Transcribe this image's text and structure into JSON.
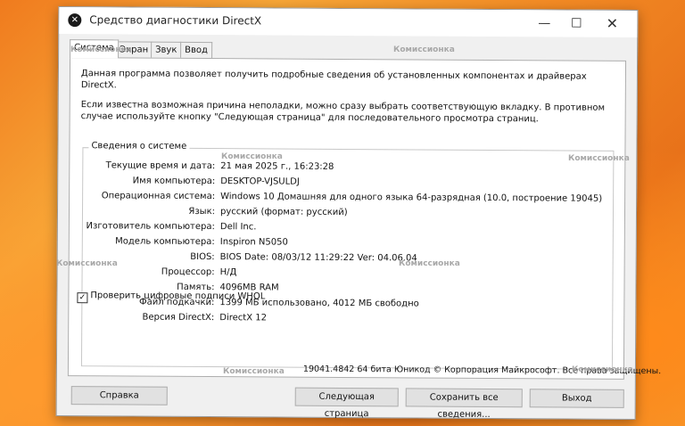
{
  "window": {
    "title": "Средство диагностики DirectX",
    "min_glyph": "—",
    "max_glyph": "☐",
    "close_glyph": "✕"
  },
  "tabs": [
    {
      "label": "Система"
    },
    {
      "label": "Экран"
    },
    {
      "label": "Звук"
    },
    {
      "label": "Ввод"
    }
  ],
  "intro": {
    "line1": "Данная программа позволяет получить подробные сведения об установленных компонентах и драйверах DirectX.",
    "line2": "Если известна возможная причина неполадки, можно сразу выбрать соответствующую вкладку. В противном случае используйте кнопку \"Следующая страница\" для последовательного просмотра страниц."
  },
  "system_info": {
    "title": "Сведения о системе",
    "rows": [
      {
        "label": "Текущие время и дата:",
        "value": "21 мая 2025 г., 16:23:28"
      },
      {
        "label": "Имя компьютера:",
        "value": "DESKTOP-VJSULDJ"
      },
      {
        "label": "Операционная система:",
        "value": "Windows 10 Домашняя для одного языка 64-разрядная (10.0, построение 19045)"
      },
      {
        "label": "Язык:",
        "value": "русский (формат: русский)"
      },
      {
        "label": "Изготовитель компьютера:",
        "value": "Dell Inc."
      },
      {
        "label": "Модель компьютера:",
        "value": "Inspiron N5050"
      },
      {
        "label": "BIOS:",
        "value": "BIOS Date: 08/03/12 11:29:22 Ver: 04.06.04"
      },
      {
        "label": "Процессор:",
        "value": "Н/Д"
      },
      {
        "label": "Память:",
        "value": "4096MB RAM"
      },
      {
        "label": "Файл подкачки:",
        "value": "1399 МБ использовано, 4012 МБ свободно"
      },
      {
        "label": "Версия DirectX:",
        "value": "DirectX 12"
      }
    ]
  },
  "whql": {
    "label": "Проверить цифровые подписи WHQL",
    "checked": true,
    "mark": "✓"
  },
  "footer": "19041.4842 64 бита Юникод © Корпорация Майкрософт. Все права защищены.",
  "buttons": {
    "help": "Справка",
    "next": "Следующая страница",
    "save": "Сохранить все сведения...",
    "exit": "Выход"
  },
  "watermark": "Комиссионка"
}
